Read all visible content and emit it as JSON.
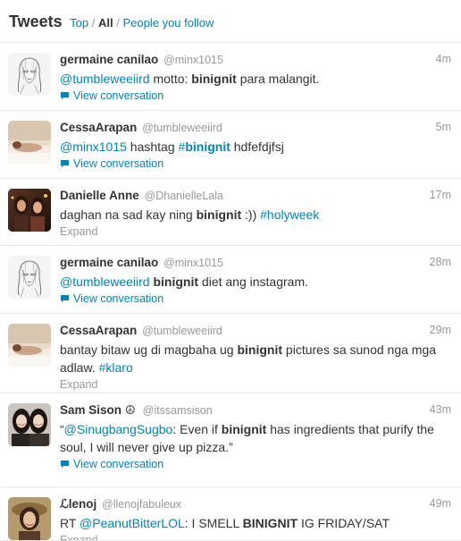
{
  "header": {
    "title": "Tweets",
    "filter_top": "Top",
    "sep1": "/",
    "filter_all": "All",
    "sep2": "/",
    "filter_people": "People you follow"
  },
  "tweets": [
    {
      "name": "germaine canilao",
      "handle": "@minx1015",
      "time": "4m",
      "segments": [
        {
          "t": "link",
          "v": "@tumbleweeiird"
        },
        {
          "t": "plain",
          "v": " motto: "
        },
        {
          "t": "bold",
          "v": "binignit"
        },
        {
          "t": "plain",
          "v": " para malangit."
        }
      ],
      "action": "View conversation",
      "action_type": "view"
    },
    {
      "name": "CessaArapan",
      "handle": "@tumbleweeiird",
      "time": "5m",
      "segments": [
        {
          "t": "link",
          "v": "@minx1015"
        },
        {
          "t": "plain",
          "v": " hashtag "
        },
        {
          "t": "link",
          "v": "#"
        },
        {
          "t": "boldlink",
          "v": "binignit"
        },
        {
          "t": "plain",
          "v": " hdfefdjfsj"
        }
      ],
      "action": "View conversation",
      "action_type": "view"
    },
    {
      "name": "Danielle Anne",
      "handle": "@DhanielleLala",
      "time": "17m",
      "segments": [
        {
          "t": "plain",
          "v": "daghan na sad kay ning "
        },
        {
          "t": "bold",
          "v": "binignit"
        },
        {
          "t": "plain",
          "v": " :)) "
        },
        {
          "t": "link",
          "v": "#holyweek"
        }
      ],
      "action": "Expand",
      "action_type": "expand"
    },
    {
      "name": "germaine canilao",
      "handle": "@minx1015",
      "time": "28m",
      "segments": [
        {
          "t": "link",
          "v": "@tumbleweeiird"
        },
        {
          "t": "plain",
          "v": " "
        },
        {
          "t": "bold",
          "v": "binignit"
        },
        {
          "t": "plain",
          "v": " diet ang instagram."
        }
      ],
      "action": "View conversation",
      "action_type": "view"
    },
    {
      "name": "CessaArapan",
      "handle": "@tumbleweeiird",
      "time": "29m",
      "segments": [
        {
          "t": "plain",
          "v": "bantay bitaw ug di magbaha ug "
        },
        {
          "t": "bold",
          "v": "binignit"
        },
        {
          "t": "plain",
          "v": " pictures sa sunod nga mga adlaw. "
        },
        {
          "t": "link",
          "v": "#klaro"
        }
      ],
      "action": "Expand",
      "action_type": "expand"
    },
    {
      "name": "Sam Sison",
      "name_emoji": "☮",
      "handle": "@itssamsison",
      "time": "43m",
      "segments": [
        {
          "t": "plain",
          "v": "“"
        },
        {
          "t": "link",
          "v": "@SinugbangSugbo"
        },
        {
          "t": "plain",
          "v": ": Even if "
        },
        {
          "t": "bold",
          "v": "binignit"
        },
        {
          "t": "plain",
          "v": " has ingredients that purify the soul, I will never give up pizza.”"
        }
      ],
      "action": "View conversation",
      "action_type": "view"
    },
    {
      "name": "ℒlenoj",
      "handle": "@llenojfabuleux",
      "time": "49m",
      "segments": [
        {
          "t": "plain",
          "v": "RT "
        },
        {
          "t": "link",
          "v": "@PeanutBitterLOL"
        },
        {
          "t": "plain",
          "v": ": I SMELL "
        },
        {
          "t": "bold",
          "v": "BINIGNIT"
        },
        {
          "t": "plain",
          "v": " IG FRIDAY/SAT"
        }
      ],
      "action": "Expand",
      "action_type": "expand"
    }
  ]
}
